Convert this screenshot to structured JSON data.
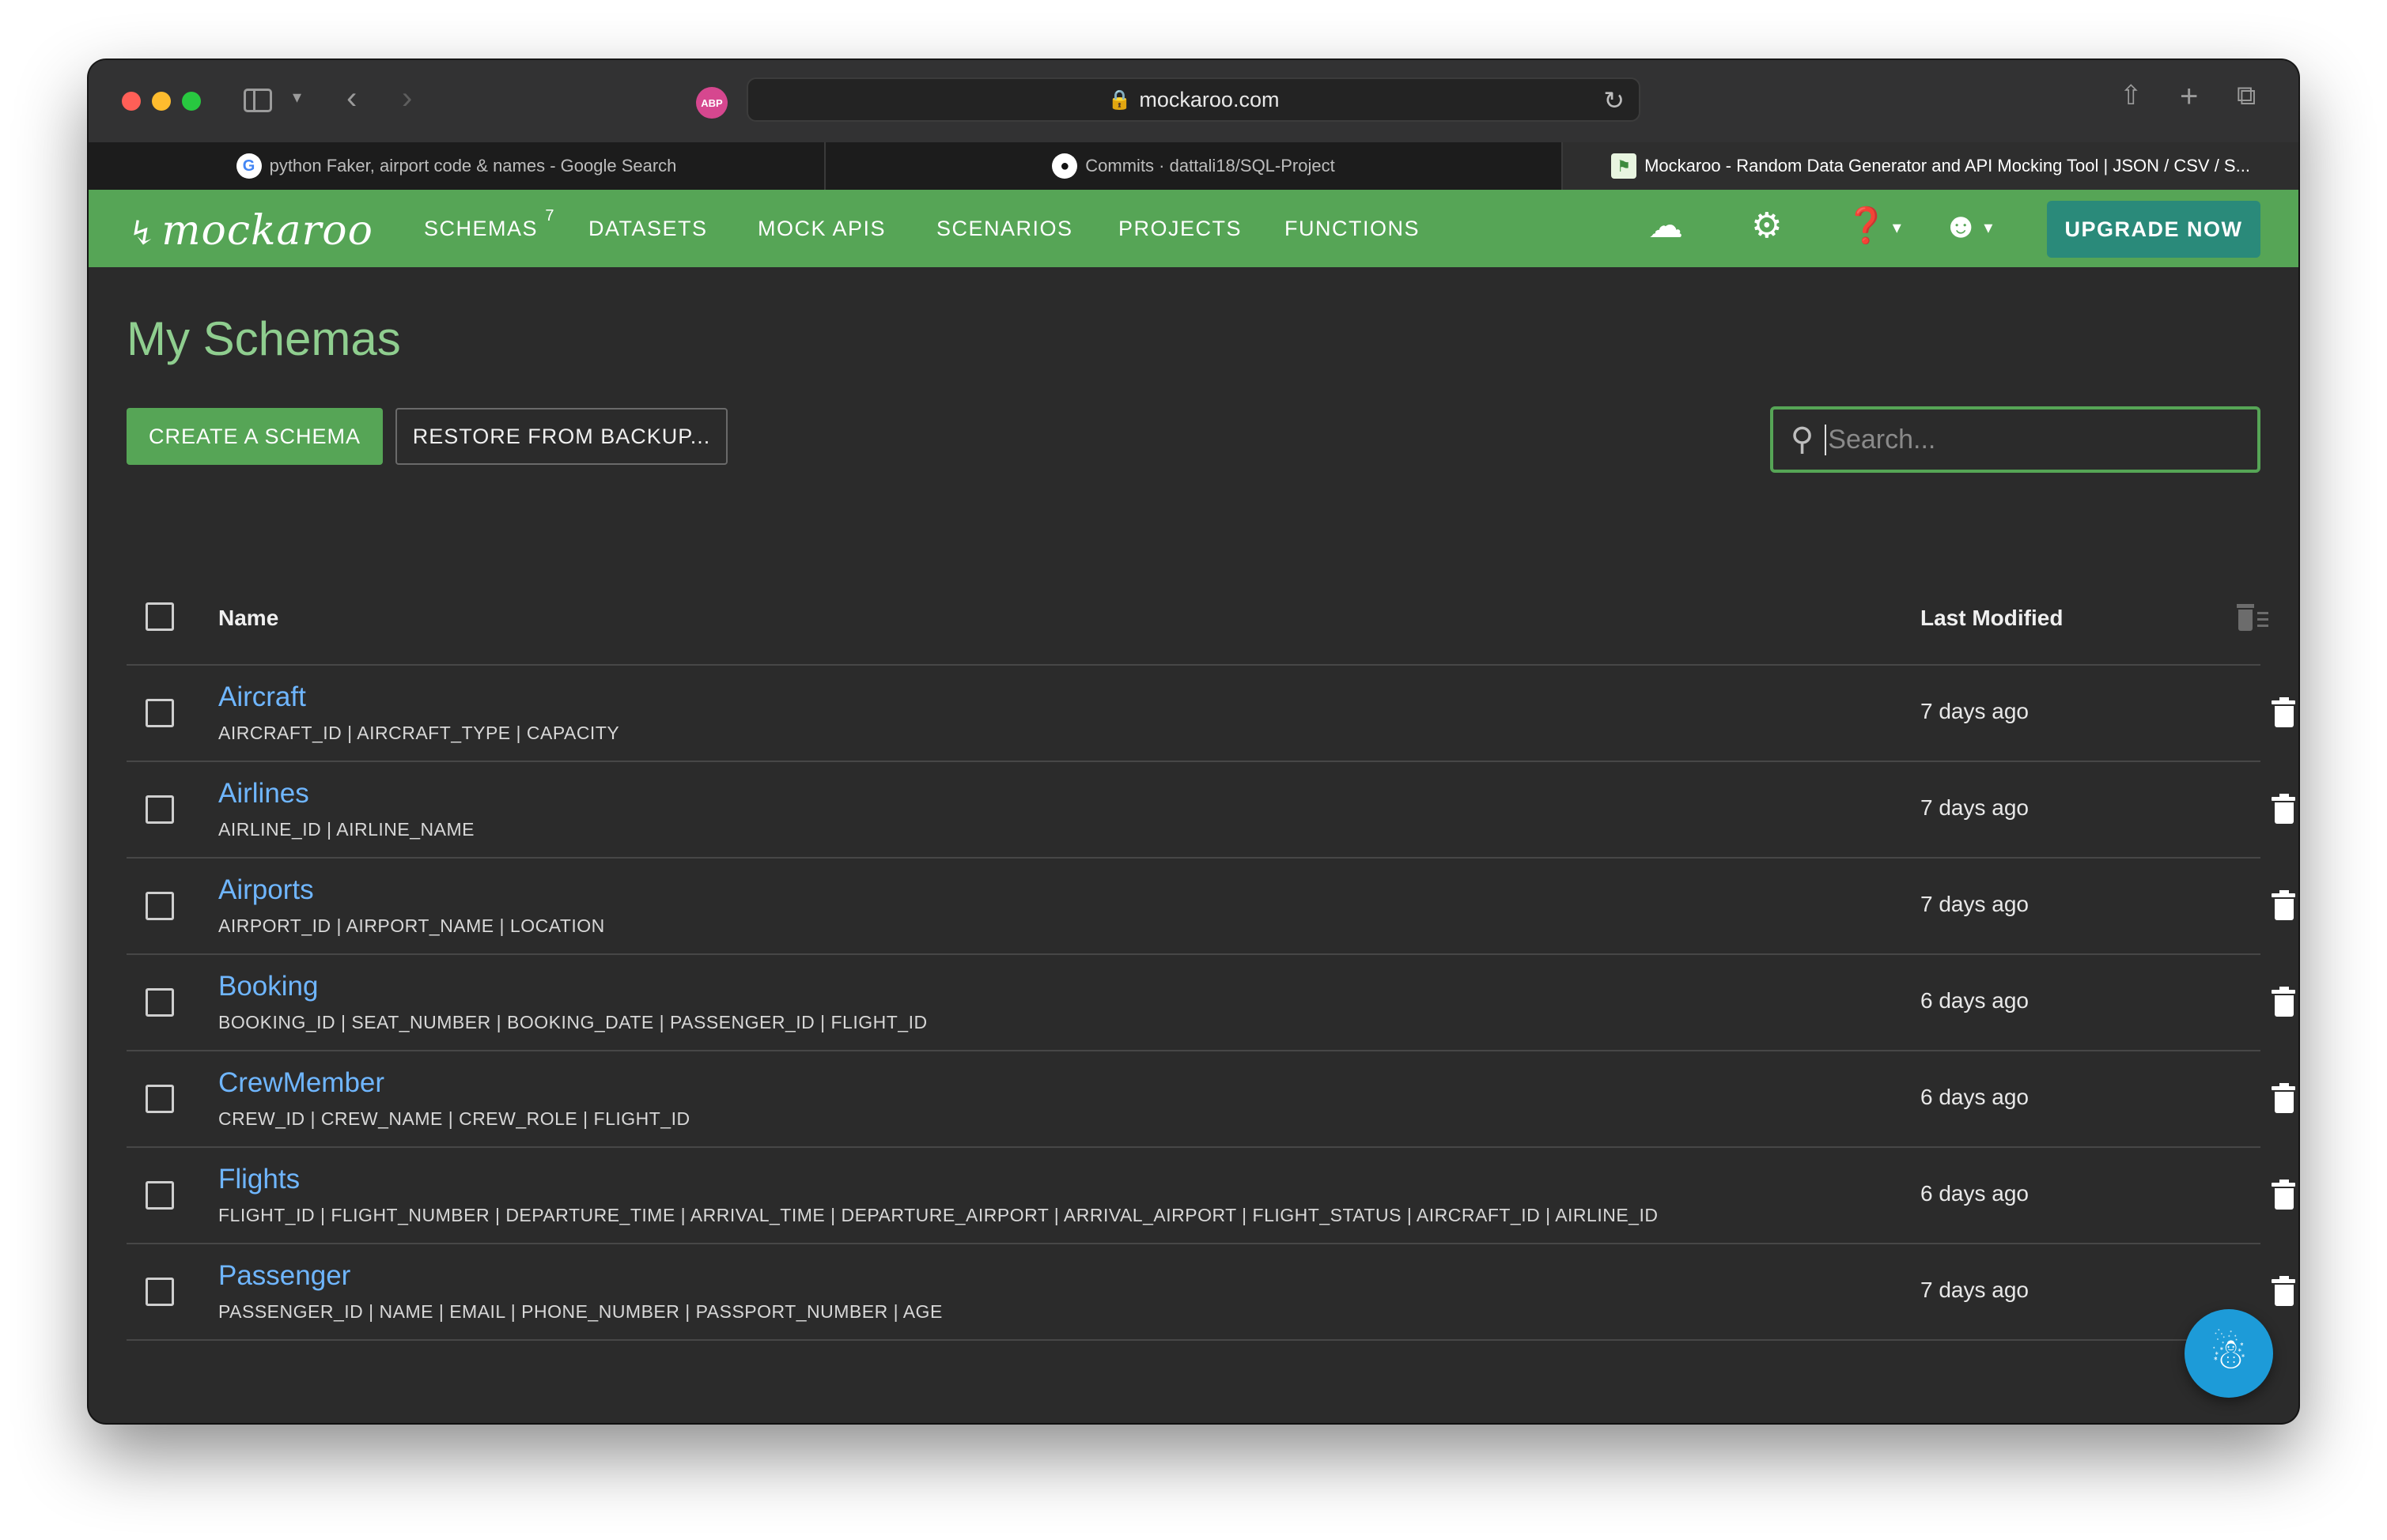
{
  "browser": {
    "url": "mockaroo.com",
    "abp_label": "ABP",
    "tabs": [
      {
        "favicon": "G",
        "label": "python Faker, airport code & names - Google Search"
      },
      {
        "favicon": "●",
        "label": "Commits · dattali18/SQL-Project"
      },
      {
        "favicon": "⚑",
        "label": "Mockaroo - Random Data Generator and API Mocking Tool | JSON / CSV / S..."
      }
    ]
  },
  "nav": {
    "logo": "mockaroo",
    "items": [
      {
        "label": "SCHEMAS",
        "badge": "7"
      },
      {
        "label": "DATASETS"
      },
      {
        "label": "MOCK APIS"
      },
      {
        "label": "SCENARIOS"
      },
      {
        "label": "PROJECTS"
      },
      {
        "label": "FUNCTIONS"
      }
    ],
    "upgrade_label": "UPGRADE NOW"
  },
  "page": {
    "title": "My Schemas",
    "create_label": "CREATE A SCHEMA",
    "restore_label": "RESTORE FROM BACKUP...",
    "search_placeholder": "Search..."
  },
  "table": {
    "columns": {
      "name": "Name",
      "modified": "Last Modified"
    },
    "rows": [
      {
        "name": "Aircraft",
        "fields": "AIRCRAFT_ID | AIRCRAFT_TYPE | CAPACITY",
        "modified": "7 days ago"
      },
      {
        "name": "Airlines",
        "fields": "AIRLINE_ID | AIRLINE_NAME",
        "modified": "7 days ago"
      },
      {
        "name": "Airports",
        "fields": "AIRPORT_ID | AIRPORT_NAME | LOCATION",
        "modified": "7 days ago"
      },
      {
        "name": "Booking",
        "fields": "BOOKING_ID | SEAT_NUMBER | BOOKING_DATE | PASSENGER_ID | FLIGHT_ID",
        "modified": "6 days ago"
      },
      {
        "name": "CrewMember",
        "fields": "CREW_ID | CREW_NAME | CREW_ROLE | FLIGHT_ID",
        "modified": "6 days ago"
      },
      {
        "name": "Flights",
        "fields": "FLIGHT_ID | FLIGHT_NUMBER | DEPARTURE_TIME | ARRIVAL_TIME | DEPARTURE_AIRPORT | ARRIVAL_AIRPORT | FLIGHT_STATUS | AIRCRAFT_ID | AIRLINE_ID",
        "modified": "6 days ago"
      },
      {
        "name": "Passenger",
        "fields": "PASSENGER_ID | NAME | EMAIL | PHONE_NUMBER | PASSPORT_NUMBER | AGE",
        "modified": "7 days ago"
      }
    ]
  },
  "colors": {
    "brand_green": "#56a556",
    "upgrade_teal": "#2a8a7a",
    "link_blue": "#6fb6ff",
    "fab_blue": "#1d9bd8"
  },
  "icons": {
    "nav": [
      "cloud-download-icon",
      "settings-icon",
      "help-icon",
      "account-icon"
    ],
    "fab": "robot-icon"
  }
}
